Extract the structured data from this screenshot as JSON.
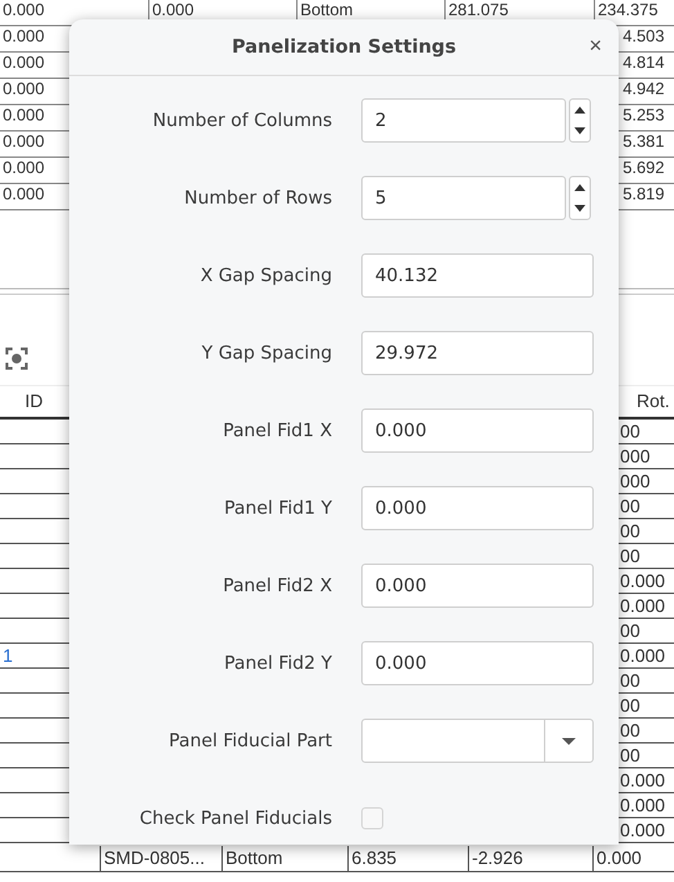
{
  "top_table": {
    "rows": [
      {
        "cells": [
          "0.000",
          "0.000",
          "Bottom",
          "281.075",
          "234.375"
        ]
      },
      {
        "cells": [
          "0.000"
        ],
        "tail": "4.503"
      },
      {
        "cells": [
          "0.000"
        ],
        "tail": "4.814"
      },
      {
        "cells": [
          "0.000"
        ],
        "tail": "4.942"
      },
      {
        "cells": [
          "0.000"
        ],
        "tail": "5.253"
      },
      {
        "cells": [
          "0.000"
        ],
        "tail": "5.381"
      },
      {
        "cells": [
          "0.000"
        ],
        "tail": "5.692"
      },
      {
        "cells": [
          "0.000"
        ],
        "tail": "5.819"
      }
    ]
  },
  "parts_table": {
    "columns": [
      "ID",
      "Rot."
    ],
    "rows": [
      {
        "tail": "00"
      },
      {
        "tail": "000"
      },
      {
        "tail": "000"
      },
      {
        "tail": "00"
      },
      {
        "tail": "00"
      },
      {
        "tail": "00"
      },
      {
        "tail": "0.000"
      },
      {
        "tail": "0.000"
      },
      {
        "tail": "00"
      },
      {
        "id": "1",
        "tail": "0.000"
      },
      {
        "tail": "00"
      },
      {
        "tail": "00"
      },
      {
        "tail": "00"
      },
      {
        "tail": "00"
      },
      {
        "tail": "0.000"
      },
      {
        "tail": "0.000"
      },
      {
        "tail": "0.000"
      }
    ],
    "full_rows": [
      {
        "cells": [
          "SMD-0805...",
          "Bottom",
          "6.835",
          "-2.926",
          "0.000"
        ]
      }
    ]
  },
  "dialog": {
    "title": "Panelization Settings",
    "close": "×",
    "fields": [
      {
        "kind": "spin",
        "label": "Number of Columns",
        "value": "2"
      },
      {
        "kind": "spin",
        "label": "Number of Rows",
        "value": "5"
      },
      {
        "kind": "text",
        "label": "X Gap Spacing",
        "value": "40.132"
      },
      {
        "kind": "text",
        "label": "Y Gap Spacing",
        "value": "29.972"
      },
      {
        "kind": "text",
        "label": "Panel Fid1 X",
        "value": "0.000"
      },
      {
        "kind": "text",
        "label": "Panel Fid1 Y",
        "value": "0.000"
      },
      {
        "kind": "text",
        "label": "Panel Fid2 X",
        "value": "0.000"
      },
      {
        "kind": "text",
        "label": "Panel Fid2 Y",
        "value": "0.000"
      },
      {
        "kind": "combo",
        "label": "Panel Fiducial Part"
      },
      {
        "kind": "checkbox",
        "label": "Check Panel Fiducials",
        "checked": false
      }
    ]
  }
}
